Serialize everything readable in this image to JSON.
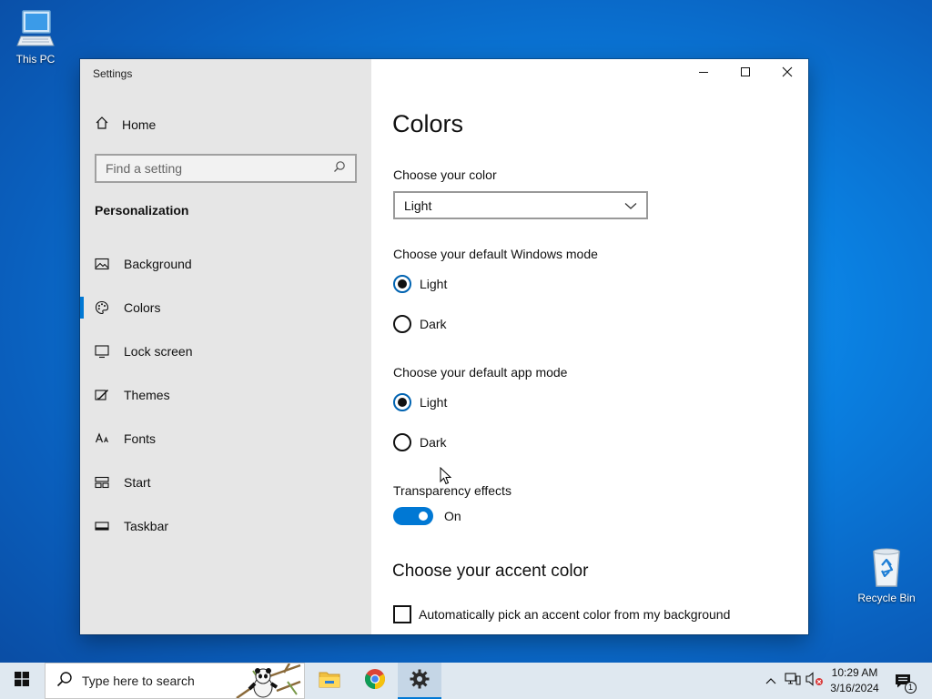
{
  "desktop": {
    "icons": [
      {
        "label": "This PC"
      },
      {
        "label": "Recycle Bin"
      }
    ]
  },
  "window": {
    "title": "Settings",
    "sidebar": {
      "home_label": "Home",
      "search_placeholder": "Find a setting",
      "section_title": "Personalization",
      "items": [
        {
          "label": "Background",
          "icon": "image-icon"
        },
        {
          "label": "Colors",
          "icon": "palette-icon",
          "active": true
        },
        {
          "label": "Lock screen",
          "icon": "lock-screen-icon"
        },
        {
          "label": "Themes",
          "icon": "brush-icon"
        },
        {
          "label": "Fonts",
          "icon": "font-icon"
        },
        {
          "label": "Start",
          "icon": "start-tiles-icon"
        },
        {
          "label": "Taskbar",
          "icon": "taskbar-icon"
        }
      ]
    },
    "content": {
      "page_title": "Colors",
      "choose_color_label": "Choose your color",
      "choose_color_value": "Light",
      "windows_mode_label": "Choose your default Windows mode",
      "windows_mode_options": [
        "Light",
        "Dark"
      ],
      "windows_mode_selected": "Light",
      "app_mode_label": "Choose your default app mode",
      "app_mode_options": [
        "Light",
        "Dark"
      ],
      "app_mode_selected": "Light",
      "transparency_label": "Transparency effects",
      "transparency_state": "On",
      "accent_title": "Choose your accent color",
      "auto_accent_label": "Automatically pick an accent color from my background",
      "auto_accent_checked": false
    }
  },
  "taskbar": {
    "search_placeholder": "Type here to search",
    "apps": [
      "file-explorer-icon",
      "chrome-icon",
      "settings-gear-icon"
    ],
    "active_app": "settings-gear-icon",
    "clock_time": "10:29 AM",
    "clock_date": "3/16/2024",
    "notification_count": "1"
  },
  "colors": {
    "accent": "#0078d4",
    "sidebar_bg": "#e6e6e6",
    "taskbar_bg": "#dfe8f0"
  }
}
